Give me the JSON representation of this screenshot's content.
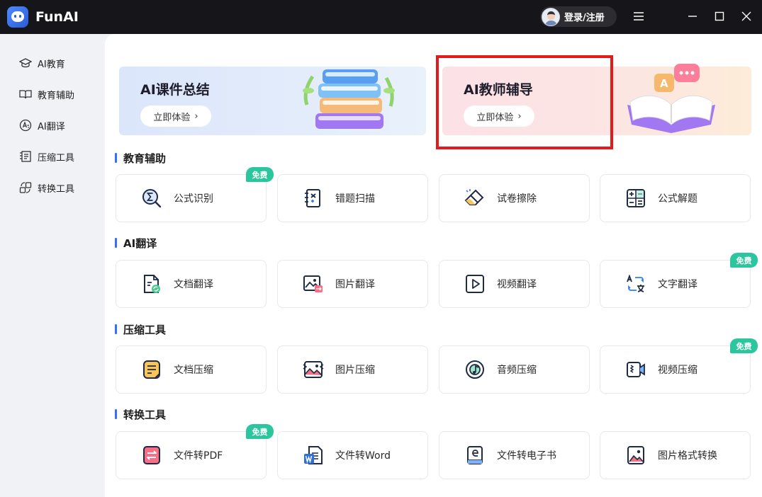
{
  "app": {
    "name": "FunAI"
  },
  "titlebar": {
    "login_label": "登录/注册"
  },
  "sidebar": {
    "items": [
      {
        "label": "AI教育",
        "icon": "graduation-cap-icon"
      },
      {
        "label": "教育辅助",
        "icon": "open-book-icon"
      },
      {
        "label": "AI翻译",
        "icon": "translate-icon"
      },
      {
        "label": "压缩工具",
        "icon": "compress-icon"
      },
      {
        "label": "转换工具",
        "icon": "convert-icon"
      }
    ]
  },
  "banners": [
    {
      "title": "AI课件总结",
      "button": "立即体验"
    },
    {
      "title": "AI教师辅导",
      "button": "立即体验"
    }
  ],
  "sections": [
    {
      "title": "教育辅助",
      "cards": [
        {
          "label": "公式识别",
          "icon": "formula-scan-icon",
          "badge": "免费"
        },
        {
          "label": "错题扫描",
          "icon": "wrong-question-scan-icon"
        },
        {
          "label": "试卷擦除",
          "icon": "eraser-icon"
        },
        {
          "label": "公式解题",
          "icon": "calculator-icon"
        }
      ]
    },
    {
      "title": "AI翻译",
      "cards": [
        {
          "label": "文档翻译",
          "icon": "document-translate-icon"
        },
        {
          "label": "图片翻译",
          "icon": "image-translate-icon"
        },
        {
          "label": "视频翻译",
          "icon": "video-play-icon"
        },
        {
          "label": "文字翻译",
          "icon": "text-translate-icon",
          "badge": "免费"
        }
      ]
    },
    {
      "title": "压缩工具",
      "cards": [
        {
          "label": "文档压缩",
          "icon": "document-compress-icon"
        },
        {
          "label": "图片压缩",
          "icon": "image-compress-icon"
        },
        {
          "label": "音频压缩",
          "icon": "audio-disc-icon"
        },
        {
          "label": "视频压缩",
          "icon": "video-camera-icon",
          "badge": "免费"
        }
      ]
    },
    {
      "title": "转换工具",
      "cards": [
        {
          "label": "文件转PDF",
          "icon": "file-to-pdf-icon",
          "badge": "免费"
        },
        {
          "label": "文件转Word",
          "icon": "word-icon"
        },
        {
          "label": "文件转电子书",
          "icon": "ebook-icon"
        },
        {
          "label": "图片格式转换",
          "icon": "image-format-icon"
        }
      ]
    }
  ],
  "colors": {
    "accent": "#3a6ff2",
    "badge": "#2cc69e",
    "highlight": "#e31a1a",
    "titlebar": "#16161a"
  }
}
